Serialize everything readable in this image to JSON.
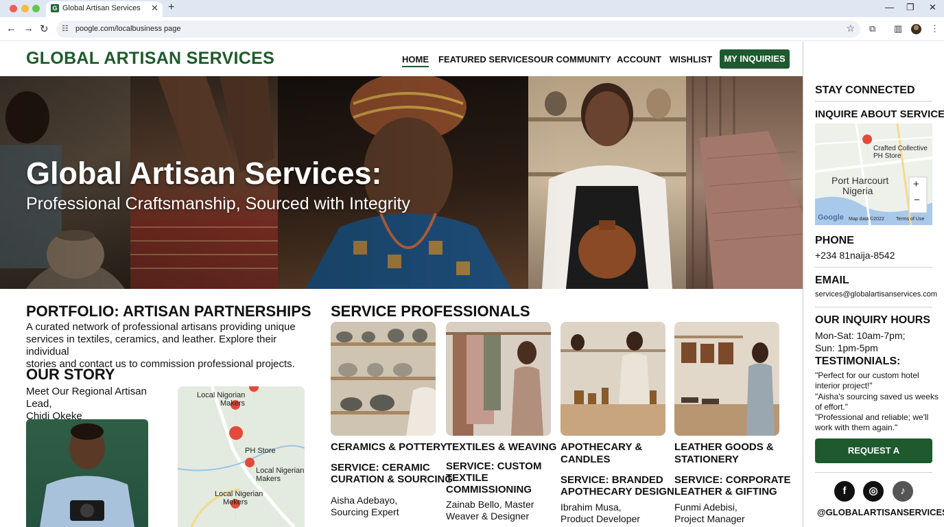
{
  "browser": {
    "tab_title": "Global Artisan Services",
    "url": "poogle.com/localbusiness page"
  },
  "header": {
    "logo": "GLOBAL ARTISAN SERVICES",
    "nav": [
      "HOME",
      "FEATURED SERVICES",
      "OUR COMMUNITY",
      "ACCOUNT",
      "WISHLIST"
    ],
    "cta": "MY INQUIRIES"
  },
  "hero": {
    "title": "Global Artisan Services:",
    "subtitle": "Professional Craftsmanship, Sourced with Integrity"
  },
  "portfolio": {
    "heading": "PORTFOLIO: ARTISAN PARTNERSHIPS",
    "lines": [
      "A curated network of professional artisans providing unique",
      "services in textiles, ceramics, and leather. Explore their individual",
      "stories and contact us to commission professional projects."
    ]
  },
  "story": {
    "heading": "OUR STORY",
    "lines": [
      "Meet Our Regional Artisan Lead,",
      "Chidi Okeke"
    ],
    "map_labels": [
      "Local Nigorian",
      "Makers",
      "PH Store",
      "Local Nigerian",
      "Makers",
      "Local Nigerian",
      "Mekers"
    ]
  },
  "services": {
    "heading": "SERVICE PROFESSIONALS",
    "cards": [
      {
        "category": [
          "CERAMICS & POTTERY"
        ],
        "title": [
          "SERVICE: CERAMIC",
          "CURATION & SOURCING"
        ],
        "person": [
          "Aisha Adebayo,",
          "Sourcing Expert"
        ]
      },
      {
        "category": [
          "TEXTILES & WEAVING"
        ],
        "title": [
          "SERVICE: CUSTOM",
          "TEXTILE",
          "COMMISSIONING"
        ],
        "person": [
          "Zainab Bello, Master",
          "Weaver & Designer"
        ]
      },
      {
        "category": [
          "APOTHECARY &",
          "CANDLES"
        ],
        "title": [
          "SERVICE: BRANDED",
          "APOTHECARY DESIGN"
        ],
        "person": [
          "Ibrahim Musa,",
          "Product Developer"
        ]
      },
      {
        "category": [
          "LEATHER GOODS &",
          "STATIONERY"
        ],
        "title": [
          "SERVICE: CORPORATE",
          "LEATHER & GIFTING"
        ],
        "person": [
          "Funmi Adebisi,",
          "Project Manager"
        ]
      }
    ]
  },
  "sidebar": {
    "stay_connected": "STAY CONNECTED",
    "inquire": "INQUIRE ABOUT SERVICES",
    "map": {
      "pin_label": [
        "Crafted Collective",
        "PH Store"
      ],
      "city": [
        "Port Harcourt",
        "Nigeria"
      ],
      "attribution": [
        "Google",
        "Map data ©2022",
        "Terms of Use"
      ]
    },
    "phone_label": "PHONE",
    "phone": "+234 81naija-8542",
    "email_label": "EMAIL",
    "email": "services@globalartisanservices.com",
    "hours_label": "OUR INQUIRY HOURS",
    "hours": [
      "Mon-Sat: 10am-7pm;",
      "Sun: 1pm-5pm"
    ],
    "testimonials_label": "TESTIMONIALS:",
    "testimonials": [
      "\"Perfect for our custom hotel interior project!\"",
      "\"Aisha's sourcing saved us weeks of effort.\"",
      "\"Professional and reliable; we'll work with them again.\""
    ],
    "cta": "REQUEST A CONSULTATION",
    "social": [
      "facebook-icon",
      "instagram-icon",
      "tiktok-icon"
    ],
    "handle": "@GLOBALARTISANSERVICES"
  },
  "colors": {
    "brand_green": "#1e5a2e",
    "logo_green": "#1f5a2c"
  }
}
